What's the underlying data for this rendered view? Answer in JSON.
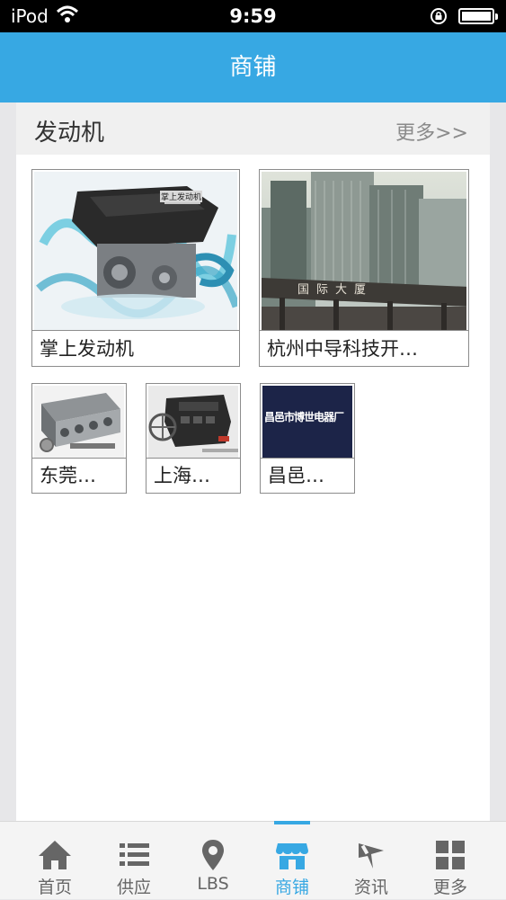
{
  "status_bar": {
    "carrier": "iPod",
    "time": "9:59"
  },
  "header": {
    "title": "商铺"
  },
  "section": {
    "title": "发动机",
    "more": "更多>>"
  },
  "shops": [
    {
      "name": "掌上发动机",
      "image": "engine-photo",
      "image_text": "掌上发动机"
    },
    {
      "name": "杭州中导科技开…",
      "image": "building-photo",
      "image_text": "国际大厦"
    },
    {
      "name": "东莞…",
      "image": "engine-block-photo"
    },
    {
      "name": "上海…",
      "image": "diesel-engine-photo"
    },
    {
      "name": "昌邑…",
      "image": "shop-sign",
      "image_text": "昌邑市博世电器厂"
    }
  ],
  "tabs": [
    {
      "label": "首页",
      "icon": "home-icon"
    },
    {
      "label": "供应",
      "icon": "list-icon"
    },
    {
      "label": "LBS",
      "icon": "location-pin-icon"
    },
    {
      "label": "商铺",
      "icon": "shop-icon",
      "active": true
    },
    {
      "label": "资讯",
      "icon": "news-icon"
    },
    {
      "label": "更多",
      "icon": "grid-icon"
    }
  ],
  "colors": {
    "accent": "#37a8e3",
    "status_bar": "#000000",
    "tab_text": "#666666"
  }
}
